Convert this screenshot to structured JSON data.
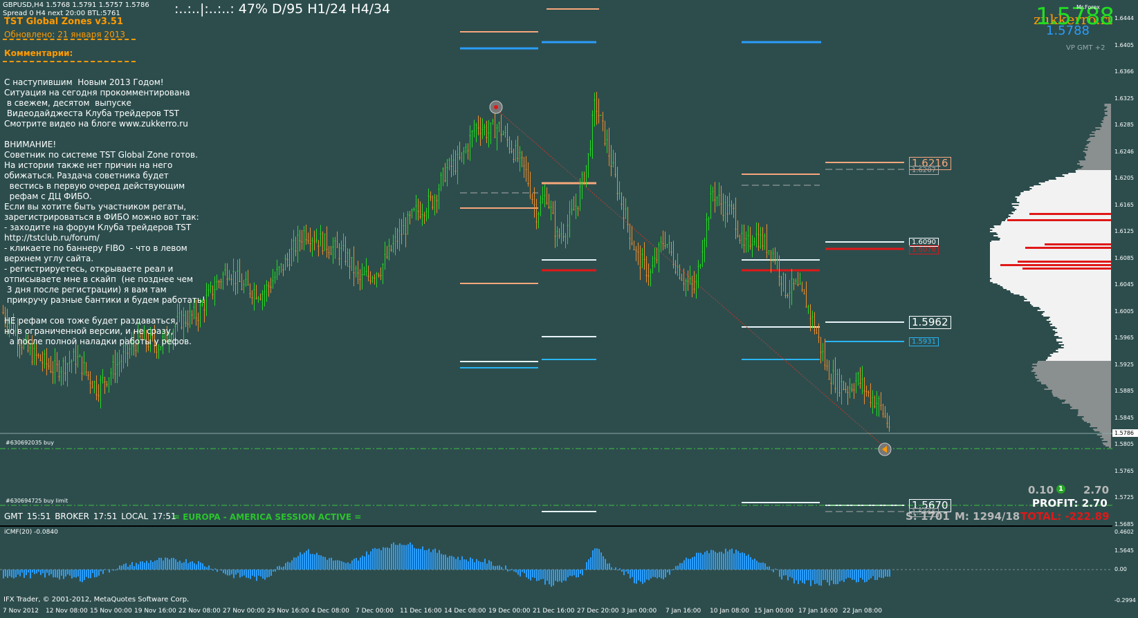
{
  "window": {
    "symbol_line": "GBPUSD,H4  1.5768 1.5791 1.5757 1.5786",
    "spread_line": "Spread 0  H4 next 20:00 BTL:5761",
    "stats_line": ":..:..|:..:..:  47%    D/95  H1/24  H4/34"
  },
  "panel": {
    "title": "TST Global Zones  v3.51",
    "updated": "Обновлено:   21 января 2013",
    "comments_heading": "Комментарии:",
    "comment_lines": [
      "С наступившим  Новым 2013 Годом!",
      "Ситуация на сегодня прокомментирована",
      " в свежем, десятом  выпуске",
      " Видеодайджеста Клуба трейдеров TST",
      "Смотрите видео на блоге www.zukkerro.ru",
      "",
      "ВНИМАНИЕ!",
      "Советник по системе TST Global Zone готов.",
      "На истории также нет причин на него",
      "обижаться. Раздача советника будет",
      "  вестись в первую очеред действующим",
      "  рефам с ДЦ ФИБО.",
      "Если вы хотите быть участником регаты,",
      "зарегистрироваться в ФИБО можно вот так:",
      "- заходите на форум Клуба трейдеров TST",
      "http://tstclub.ru/forum/",
      "- кликаете по баннеру FIBO  - что в левом",
      "верхнем углу сайта.",
      "- регистрируетесь, открываете реал и",
      "отписываете мне в скайп  (не позднее чем",
      " 3 дня после регистрации) я вам там",
      " прикручу разные бантики и будем работать!",
      "",
      "НЕ рефам сов тоже будет раздаваться,",
      "но в ограниченной версии, и не сразу,",
      "  а после полной наладки работы у рефов."
    ]
  },
  "top_right": {
    "big_price": "1.5788",
    "brand": "zukkerro.ru",
    "marker": "Mr.Forex",
    "blue_price": "1.5788",
    "vp_label": "VP GMT +2"
  },
  "orders": {
    "buy": "#630692035 buy",
    "buy_limit": "#630694725 buy limit"
  },
  "status": {
    "times": "GMT 15:51   BROKER 17:51   LOCAL 17:51",
    "session": "= EUROPA - AMERICA SESSION ACTIVE ="
  },
  "trade": {
    "lots": "0.10",
    "badge": "1",
    "value": "2.70",
    "profit": "PROFIT: 2.70",
    "s": "S: 1701",
    "m": "M: 1294/18",
    "total": "TOTAL: -222.89"
  },
  "levels": {
    "l1": "1.6216",
    "l1b": "1.6207",
    "l2": "1.6090",
    "l2b": "1.6078",
    "l3": "1.5962",
    "l4": "1.5931",
    "l5": "1.5670",
    "l5b": "1.5665"
  },
  "indicator": {
    "label": "iCMF(20) -0.0840",
    "axis_labels": [
      "0.4602",
      "0.00",
      "-0.2994"
    ]
  },
  "copyright": "IFX Trader, © 2001-2012, MetaQuotes Software Corp.",
  "price_axis": {
    "labels": [
      "1.6444",
      "1.6405",
      "1.6366",
      "1.6325",
      "1.6285",
      "1.6246",
      "1.6205",
      "1.6165",
      "1.6125",
      "1.6085",
      "1.6045",
      "1.6005",
      "1.5965",
      "1.5925",
      "1.5885",
      "1.5845",
      "1.5805",
      "1.5765",
      "1.5725",
      "1.5685",
      "1.5645"
    ],
    "current": "1.5786"
  },
  "time_axis": {
    "labels": [
      "7 Nov 2012",
      "12 Nov 08:00",
      "15 Nov 00:00",
      "19 Nov 16:00",
      "22 Nov 08:00",
      "27 Nov 00:00",
      "29 Nov 16:00",
      "4 Dec 08:00",
      "7 Dec 00:00",
      "11 Dec 16:00",
      "14 Dec 08:00",
      "19 Dec 00:00",
      "21 Dec 16:00",
      "27 Dec 20:00",
      "3 Jan 00:00",
      "7 Jan 16:00",
      "10 Jan 08:00",
      "15 Jan 00:00",
      "17 Jan 16:00",
      "22 Jan 08:00"
    ]
  },
  "chart_data": {
    "type": "candlestick",
    "symbol": "GBPUSD",
    "timeframe": "H4",
    "y_range": [
      1.5625,
      1.6464
    ],
    "close_path": [
      [
        0,
        1.5975
      ],
      [
        40,
        1.5905
      ],
      [
        80,
        1.5875
      ],
      [
        110,
        1.5895
      ],
      [
        140,
        1.5845
      ],
      [
        170,
        1.5885
      ],
      [
        200,
        1.5925
      ],
      [
        230,
        1.5915
      ],
      [
        260,
        1.5955
      ],
      [
        285,
        1.5965
      ],
      [
        310,
        1.601
      ],
      [
        330,
        1.604
      ],
      [
        350,
        1.601
      ],
      [
        380,
        1.6
      ],
      [
        410,
        1.6045
      ],
      [
        440,
        1.61
      ],
      [
        470,
        1.608
      ],
      [
        500,
        1.606
      ],
      [
        520,
        1.602
      ],
      [
        550,
        1.604
      ],
      [
        575,
        1.609
      ],
      [
        600,
        1.613
      ],
      [
        625,
        1.615
      ],
      [
        645,
        1.62
      ],
      [
        665,
        1.6215
      ],
      [
        690,
        1.6275
      ],
      [
        705,
        1.626
      ],
      [
        720,
        1.627
      ],
      [
        740,
        1.6235
      ],
      [
        760,
        1.6195
      ],
      [
        775,
        1.613
      ],
      [
        790,
        1.616
      ],
      [
        805,
        1.609
      ],
      [
        820,
        1.611
      ],
      [
        835,
        1.615
      ],
      [
        850,
        1.622
      ],
      [
        860,
        1.631
      ],
      [
        875,
        1.625
      ],
      [
        890,
        1.618
      ],
      [
        905,
        1.612
      ],
      [
        920,
        1.606
      ],
      [
        940,
        1.603
      ],
      [
        960,
        1.609
      ],
      [
        975,
        1.605
      ],
      [
        990,
        1.602
      ],
      [
        1005,
        1.6005
      ],
      [
        1015,
        1.608
      ],
      [
        1030,
        1.6165
      ],
      [
        1045,
        1.614
      ],
      [
        1060,
        1.613
      ],
      [
        1075,
        1.607
      ],
      [
        1090,
        1.6095
      ],
      [
        1105,
        1.608
      ],
      [
        1120,
        1.606
      ],
      [
        1135,
        1.6005
      ],
      [
        1150,
        1.601
      ],
      [
        1165,
        1.5985
      ],
      [
        1180,
        1.5935
      ],
      [
        1195,
        1.5875
      ],
      [
        1210,
        1.5855
      ],
      [
        1225,
        1.5845
      ],
      [
        1240,
        1.586
      ],
      [
        1255,
        1.5835
      ],
      [
        1270,
        1.582
      ],
      [
        1285,
        1.5785
      ]
    ],
    "indicator_series": {
      "name": "iCMF(20)",
      "y_range": [
        -0.2994,
        0.4602
      ],
      "path": [
        [
          0,
          -0.06
        ],
        [
          60,
          -0.05
        ],
        [
          120,
          -0.09
        ],
        [
          180,
          0.05
        ],
        [
          230,
          0.12
        ],
        [
          280,
          0.1
        ],
        [
          330,
          -0.05
        ],
        [
          380,
          -0.09
        ],
        [
          440,
          0.23
        ],
        [
          500,
          0.06
        ],
        [
          540,
          0.24
        ],
        [
          580,
          0.32
        ],
        [
          620,
          0.24
        ],
        [
          660,
          0.14
        ],
        [
          700,
          0.1
        ],
        [
          760,
          -0.06
        ],
        [
          800,
          -0.14
        ],
        [
          840,
          -0.04
        ],
        [
          860,
          0.28
        ],
        [
          880,
          0.06
        ],
        [
          920,
          -0.12
        ],
        [
          960,
          -0.08
        ],
        [
          990,
          0.12
        ],
        [
          1020,
          0.22
        ],
        [
          1060,
          0.22
        ],
        [
          1100,
          0.1
        ],
        [
          1130,
          -0.07
        ],
        [
          1160,
          -0.13
        ],
        [
          1200,
          -0.12
        ],
        [
          1230,
          -0.1
        ],
        [
          1260,
          -0.09
        ],
        [
          1285,
          -0.08
        ]
      ]
    }
  },
  "colors": {
    "background": "#2d4d4d",
    "bull": "#22dd22",
    "bear": "#f08e2c",
    "orange": "#ff9a00",
    "red": "#e01818",
    "blue": "#2a9dfd",
    "green_dash": "#3fc33f"
  }
}
